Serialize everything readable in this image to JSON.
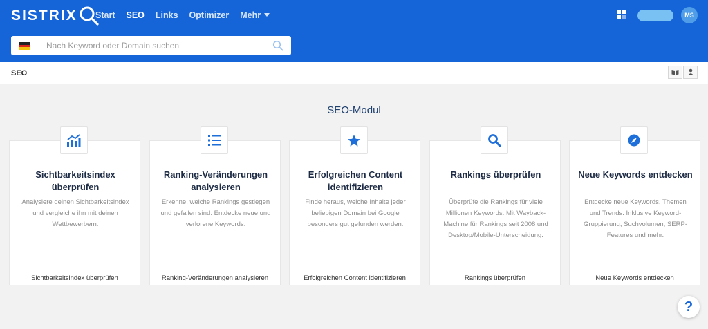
{
  "app": {
    "logo_text": "SISTRIX"
  },
  "nav": {
    "items": [
      {
        "label": "Start",
        "active": false
      },
      {
        "label": "SEO",
        "active": true
      },
      {
        "label": "Links",
        "active": false
      },
      {
        "label": "Optimizer",
        "active": false
      },
      {
        "label": "Mehr",
        "active": false
      }
    ]
  },
  "user": {
    "initials": "MS"
  },
  "search": {
    "placeholder": "Nach Keyword oder Domain suchen",
    "value": "",
    "country_flag": "flag-de-icon"
  },
  "subbar": {
    "title": "SEO",
    "buttons": [
      "book-icon",
      "user-settings-icon"
    ]
  },
  "main": {
    "title": "SEO-Modul",
    "cards": [
      {
        "icon": "chart-icon",
        "title": "Sichtbarkeitsindex überprüfen",
        "description": "Analysiere deinen Sichtbarkeitsindex und vergleiche ihn mit deinen Wettbewerbern.",
        "link": "Sichtbarkeitsindex überprüfen"
      },
      {
        "icon": "ranked-list-icon",
        "title": "Ranking-Veränderungen analysieren",
        "description": "Erkenne, welche Rankings gestiegen und gefallen sind. Entdecke neue und verlorene Keywords.",
        "link": "Ranking-Veränderungen analysieren"
      },
      {
        "icon": "star-icon",
        "title": "Erfolgreichen Content identifizieren",
        "description": "Finde heraus, welche Inhalte jeder beliebigen Domain bei Google besonders gut gefunden werden.",
        "link": "Erfolgreichen Content identifizieren"
      },
      {
        "icon": "search-icon",
        "title": "Rankings überprüfen",
        "description": "Überprüfe die Rankings für viele Millionen Keywords. Mit Wayback-Machine für Rankings seit 2008 und Desktop/Mobile-Unterscheidung.",
        "link": "Rankings überprüfen"
      },
      {
        "icon": "compass-icon",
        "title": "Neue Keywords entdecken",
        "description": "Entdecke neue Keywords, Themen und Trends. Inklusive Keyword-Gruppierung, Suchvolumen, SERP-Features und mehr.",
        "link": "Neue Keywords entdecken"
      }
    ]
  },
  "help": {
    "label": "?"
  },
  "colors": {
    "brand_blue": "#1565d8",
    "icon_blue": "#1e6fd9",
    "background": "#f2f2f2"
  }
}
